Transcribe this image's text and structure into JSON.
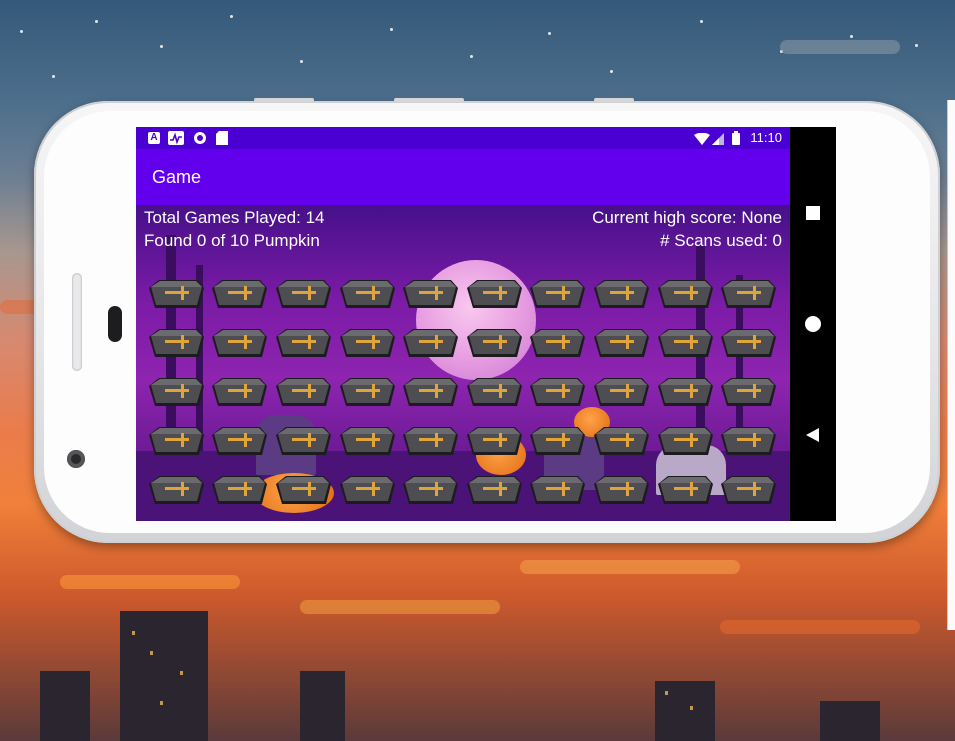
{
  "status_bar": {
    "left_icons": [
      "A",
      "activity-icon",
      "circle-icon",
      "sd-card-icon"
    ],
    "time": "11:10"
  },
  "app_bar": {
    "title": "Game"
  },
  "game": {
    "games_played_label": "Total Games Played: 14",
    "found_label": "Found 0 of 10 Pumpkin",
    "high_score_label": "Current high score: None",
    "scans_label": "# Scans used: 0",
    "grid_rows": 5,
    "grid_cols": 10,
    "tile_icon": "coffin-icon"
  },
  "nav_bar": {
    "buttons": [
      "recents-square-icon",
      "home-circle-icon",
      "back-triangle-icon"
    ]
  },
  "colors": {
    "status_bar": "#4b00d3",
    "app_bar": "#6200ee",
    "game_background": "#7a1ba6"
  }
}
